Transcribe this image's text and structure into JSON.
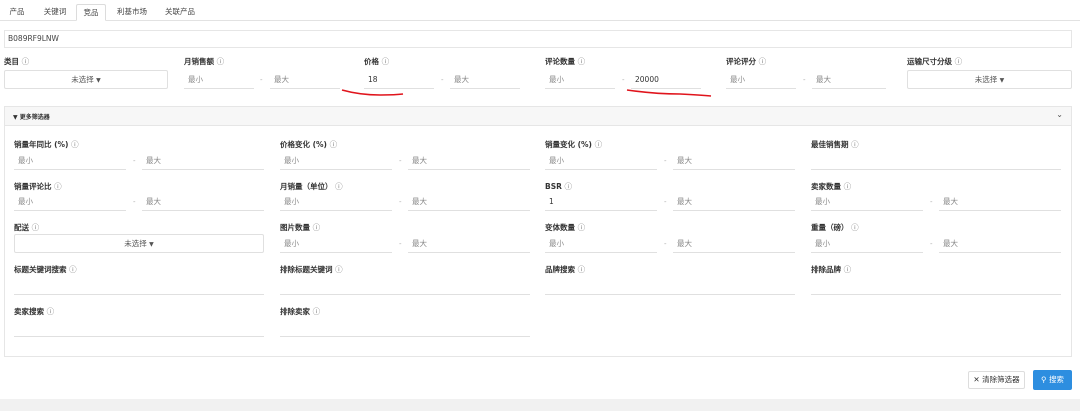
{
  "tabs": [
    "产品",
    "关键词",
    "竞品",
    "利基市场",
    "关联产品"
  ],
  "asin_value": "B089RF9LNW",
  "top_filters": {
    "category": {
      "label": "类目",
      "select": "未选择"
    },
    "monthly_sales": {
      "label": "月销售额",
      "min": "最小",
      "max": "最大"
    },
    "price": {
      "label": "价格",
      "min": "18",
      "max": "最大"
    },
    "review_count": {
      "label": "评论数量",
      "min": "最小",
      "max": "20000"
    },
    "review_rating": {
      "label": "评论评分",
      "min": "最小",
      "max": "最大"
    },
    "shipping_size": {
      "label": "运输尺寸分级",
      "select": "未选择"
    }
  },
  "more_filters": {
    "title": "更多筛选器",
    "sales_yoy": {
      "label": "销量年同比 (%)",
      "min": "最小",
      "max": "最大"
    },
    "price_change": {
      "label": "价格变化 (%)",
      "min": "最小",
      "max": "最大"
    },
    "sales_change": {
      "label": "销量变化 (%)",
      "min": "最小",
      "max": "最大"
    },
    "best_sales_period": {
      "label": "最佳销售期"
    },
    "sales_review_ratio": {
      "label": "销量评论比",
      "min": "最小",
      "max": "最大"
    },
    "monthly_units": {
      "label": "月销量（单位）",
      "min": "最小",
      "max": "最大"
    },
    "bsr": {
      "label": "BSR",
      "min": "1",
      "max": "最大"
    },
    "seller_count": {
      "label": "卖家数量",
      "min": "最小",
      "max": "最大"
    },
    "delivery": {
      "label": "配送",
      "select": "未选择"
    },
    "image_count": {
      "label": "图片数量",
      "min": "最小",
      "max": "最大"
    },
    "variant_count": {
      "label": "变体数量",
      "min": "最小",
      "max": "最大"
    },
    "weight": {
      "label": "重量（磅）",
      "min": "最小",
      "max": "最大"
    },
    "title_keyword_search": {
      "label": "标题关键词搜索"
    },
    "exclude_title_keywords": {
      "label": "排除标题关键词"
    },
    "brand_search": {
      "label": "品牌搜索"
    },
    "exclude_brands": {
      "label": "排除品牌"
    },
    "seller_search": {
      "label": "卖家搜索"
    },
    "exclude_sellers": {
      "label": "排除卖家"
    }
  },
  "buttons": {
    "clear": "清除筛选器",
    "search": "搜索"
  },
  "icons": {
    "help": "?",
    "filter": "▼",
    "chevron": "⌄",
    "clear": "✕",
    "search": "🔍"
  },
  "colors": {
    "accent": "#2d8ee0",
    "annotation": "#e0141c"
  }
}
